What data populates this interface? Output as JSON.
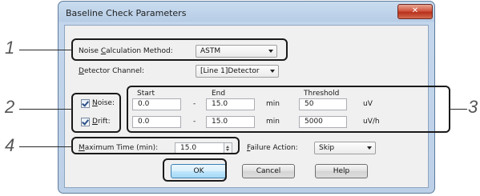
{
  "dialog": {
    "title": "Baseline Check Parameters",
    "close_glyph": "✕"
  },
  "noise_calc": {
    "label_pre": "Noise ",
    "label_key": "C",
    "label_post": "alculation Method:",
    "value": "ASTM"
  },
  "detector": {
    "label_key": "D",
    "label_post": "etector Channel:",
    "value": "[Line 1]Detector"
  },
  "columns": {
    "start": "Start",
    "end": "End",
    "threshold": "Threshold"
  },
  "rows": [
    {
      "checked": true,
      "label_key": "N",
      "label_post": "oise:",
      "start": "0.0",
      "dash": "-",
      "end": "15.0",
      "unit": "min",
      "threshold": "50",
      "threshold_unit": "uV"
    },
    {
      "checked": true,
      "label_key": "D",
      "label_post": "rift:",
      "start": "0.0",
      "dash": "-",
      "end": "15.0",
      "unit": "min",
      "threshold": "5000",
      "threshold_unit": "uV/h"
    }
  ],
  "max_time": {
    "label_key": "M",
    "label_post": "aximum Time (min):",
    "value": "15.0"
  },
  "failure_action": {
    "label_key": "F",
    "label_post": "ailure Action:",
    "value": "Skip"
  },
  "buttons": {
    "ok": "OK",
    "cancel": "Cancel",
    "help": "Help"
  },
  "callouts": [
    "1",
    "2",
    "3",
    "4"
  ],
  "colors": {
    "callout_outline": "#1a1a1a",
    "close_button": "#c4432c",
    "default_button_border": "#3c7fb1"
  }
}
